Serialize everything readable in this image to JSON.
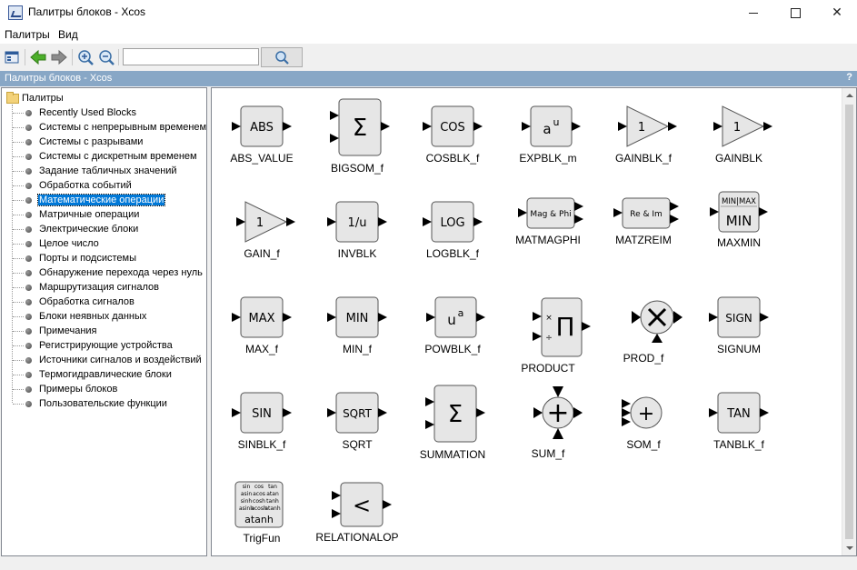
{
  "window": {
    "title": "Палитры блоков - Xcos",
    "close_glyph": "✕"
  },
  "menu": [
    "Палитры",
    "Вид"
  ],
  "toolbar": {
    "search_value": "",
    "icons": [
      "palette-icon",
      "back-arrow-icon",
      "forward-arrow-icon",
      "zoom-in-icon",
      "zoom-out-icon",
      "magnifier-icon"
    ]
  },
  "panel": {
    "title": "Палитры блоков - Xcos",
    "help": "?"
  },
  "tree": {
    "root": "Палитры",
    "items": [
      "Recently Used Blocks",
      "Системы с непрерывным временем",
      "Системы с разрывами",
      "Системы с дискретным временем",
      "Задание табличных значений",
      "Обработка событий",
      "Математические операции",
      "Матричные операции",
      "Электрические блоки",
      "Целое число",
      "Порты и подсистемы",
      "Обнаружение перехода через нуль",
      "Маршрутизация сигналов",
      "Обработка сигналов",
      "Блоки неявных данных",
      "Примечания",
      "Регистрирующие устройства",
      "Источники сигналов и воздействий",
      "Термогидравлические блоки",
      "Примеры блоков",
      "Пользовательские функции"
    ],
    "selected_index": 6
  },
  "blocks": [
    {
      "name": "ABS_VALUE",
      "symbol": "ABS"
    },
    {
      "name": "BIGSOM_f",
      "symbol": "Σ"
    },
    {
      "name": "COSBLK_f",
      "symbol": "COS"
    },
    {
      "name": "EXPBLK_m",
      "symbol": "a",
      "sup": "u"
    },
    {
      "name": "GAINBLK_f",
      "symbol": "1"
    },
    {
      "name": "GAINBLK",
      "symbol": "1"
    },
    {
      "name": "GAIN_f",
      "symbol": "1"
    },
    {
      "name": "INVBLK",
      "symbol": "1/u"
    },
    {
      "name": "LOGBLK_f",
      "symbol": "LOG"
    },
    {
      "name": "MATMAGPHI",
      "symbol": "Mag & Phi"
    },
    {
      "name": "MATZREIM",
      "symbol": "Re & Im"
    },
    {
      "name": "MAXMIN",
      "symbol": "MIN",
      "top": "MIN|MAX"
    },
    {
      "name": "MAX_f",
      "symbol": "MAX"
    },
    {
      "name": "MIN_f",
      "symbol": "MIN"
    },
    {
      "name": "POWBLK_f",
      "symbol": "u",
      "sup": "a"
    },
    {
      "name": "PRODUCT",
      "symbol": "Π",
      "in1": "×",
      "in2": "÷"
    },
    {
      "name": "PROD_f",
      "symbol": "×"
    },
    {
      "name": "SIGNUM",
      "symbol": "SIGN"
    },
    {
      "name": "SINBLK_f",
      "symbol": "SIN"
    },
    {
      "name": "SQRT",
      "symbol": "SQRT"
    },
    {
      "name": "SUMMATION",
      "symbol": "Σ"
    },
    {
      "name": "SUM_f",
      "symbol": "+"
    },
    {
      "name": "SOM_f",
      "symbol": "+"
    },
    {
      "name": "TANBLK_f",
      "symbol": "TAN"
    },
    {
      "name": "TrigFun",
      "symbol": "atanh",
      "grid": [
        [
          "sin",
          "cos",
          "tan"
        ],
        [
          "asin",
          "acos",
          "atan"
        ],
        [
          "sinh",
          "cosh",
          "tanh"
        ],
        [
          "asinh",
          "acosh",
          "atanh"
        ]
      ]
    },
    {
      "name": "RELATIONALOP",
      "symbol": "<"
    }
  ]
}
